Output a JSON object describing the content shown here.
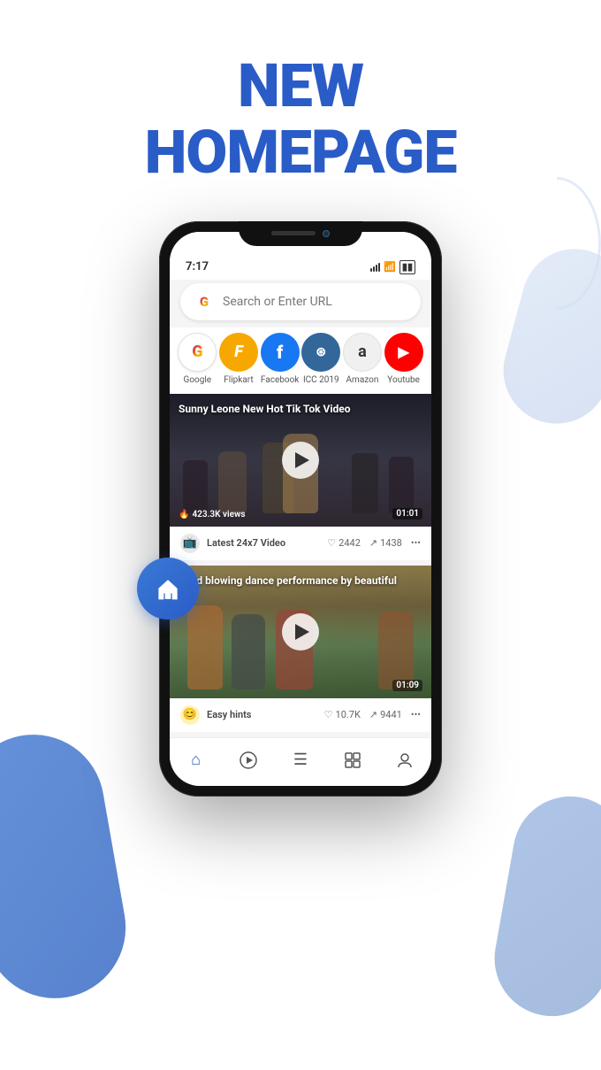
{
  "header": {
    "line1": "NEW",
    "line2": "HOMEPAGE"
  },
  "phone": {
    "status": {
      "time": "7:17",
      "signal": "●●●",
      "wifi": "WiFi",
      "battery": "Battery"
    },
    "searchbar": {
      "placeholder": "Search or Enter URL"
    },
    "shortcuts": [
      {
        "label": "Google",
        "color": "#fff",
        "icon": "G",
        "bg": "#fff",
        "border": "#e0e0e0"
      },
      {
        "label": "Flipkart",
        "color": "#fff",
        "icon": "F",
        "bg": "#f7a800"
      },
      {
        "label": "Facebook",
        "color": "#fff",
        "icon": "f",
        "bg": "#1877f2"
      },
      {
        "label": "ICC 2019",
        "color": "#fff",
        "icon": "⊛",
        "bg": "#336699"
      },
      {
        "label": "Amazon",
        "color": "#333",
        "icon": "a",
        "bg": "#f0f0f0"
      },
      {
        "label": "Youtube",
        "color": "#fff",
        "icon": "▶",
        "bg": "#ff0000"
      }
    ],
    "videos": [
      {
        "title": "Sunny Leone New Hot Tik Tok Video",
        "views": "423.3K views",
        "duration": "01:01",
        "channel": "Latest 24x7 Video",
        "likes": "2442",
        "shares": "1438"
      },
      {
        "title": "Mind blowing dance performance by beautiful",
        "views": "",
        "duration": "01:09",
        "channel": "Easy hints",
        "likes": "10.7K",
        "shares": "9441"
      }
    ],
    "bottomNav": [
      {
        "icon": "⌂",
        "label": "home",
        "active": true
      },
      {
        "icon": "▷",
        "label": "play",
        "active": false
      },
      {
        "icon": "☰",
        "label": "menu",
        "active": false
      },
      {
        "icon": "▣",
        "label": "grid",
        "active": false
      },
      {
        "icon": "👤",
        "label": "profile",
        "active": false
      }
    ]
  }
}
